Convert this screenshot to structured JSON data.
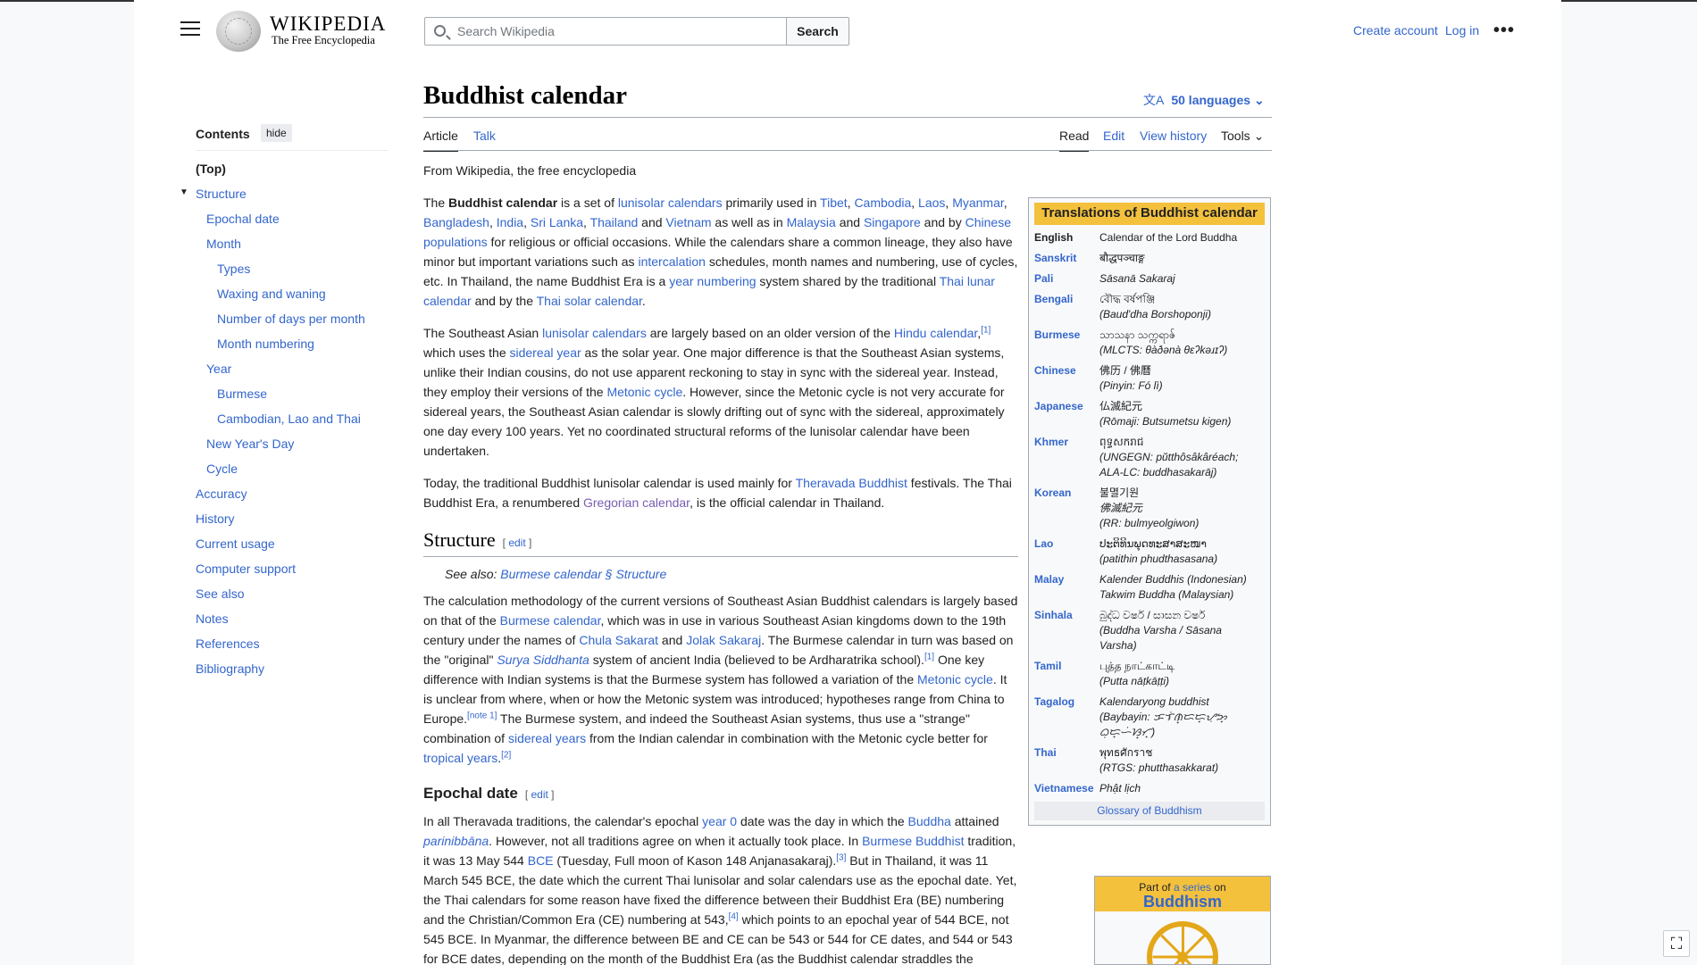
{
  "header": {
    "wordmark": "WIKIPEDIA",
    "tagline": "The Free Encyclopedia",
    "search_placeholder": "Search Wikipedia",
    "search_button": "Search",
    "create_account": "Create account",
    "log_in": "Log in"
  },
  "toc": {
    "heading": "Contents",
    "hide": "hide",
    "items": [
      "(Top)",
      "Structure",
      "Epochal date",
      "Month",
      "Types",
      "Waxing and waning",
      "Number of days per month",
      "Month numbering",
      "Year",
      "Burmese",
      "Cambodian, Lao and Thai",
      "New Year's Day",
      "Cycle",
      "Accuracy",
      "History",
      "Current usage",
      "Computer support",
      "See also",
      "Notes",
      "References",
      "Bibliography"
    ]
  },
  "page": {
    "title": "Buddhist calendar",
    "languages": "50 languages",
    "tabs": {
      "article": "Article",
      "talk": "Talk",
      "read": "Read",
      "edit": "Edit",
      "history": "View history",
      "tools": "Tools"
    },
    "from": "From Wikipedia, the free encyclopedia"
  },
  "article": {
    "p1": {
      "t1": "The ",
      "b": "Buddhist calendar",
      "t2": " is a set of ",
      "l1": "lunisolar calendars",
      "t3": " primarily used in ",
      "l2": "Tibet",
      "l3": "Cambodia",
      "l4": "Laos",
      "l5": "Myanmar",
      "l6": "Bangladesh",
      "l7": "India",
      "l8": "Sri Lanka",
      "l9": "Thailand",
      "t4": " and ",
      "l10": "Vietnam",
      "t5": " as well as in ",
      "l11": "Malaysia",
      "l12": "Singapore",
      "t6": " and by ",
      "l13": "Chinese populations",
      "t7": " for religious or official occasions. While the calendars share a common lineage, they also have minor but important variations such as ",
      "l14": "intercalation",
      "t8": " schedules, month names and numbering, use of cycles, etc. In Thailand, the name Buddhist Era is a ",
      "l15": "year numbering",
      "t9": " system shared by the traditional ",
      "l16": "Thai lunar calendar",
      "t10": " and by the ",
      "l17": "Thai solar calendar",
      "t11": "."
    },
    "p2": {
      "t1": "The Southeast Asian ",
      "l1": "lunisolar calendars",
      "t2": " are largely based on an older version of the ",
      "l2": "Hindu calendar",
      "r1": "[1]",
      "t3": " which uses the ",
      "l3": "sidereal year",
      "t4": " as the solar year. One major difference is that the Southeast Asian systems, unlike their Indian cousins, do not use apparent reckoning to stay in sync with the sidereal year. Instead, they employ their versions of the ",
      "l4": "Metonic cycle",
      "t5": ". However, since the Metonic cycle is not very accurate for sidereal years, the Southeast Asian calendar is slowly drifting out of sync with the sidereal, approximately one day every 100 years. Yet no coordinated structural reforms of the lunisolar calendar have been undertaken."
    },
    "p3": {
      "t1": "Today, the traditional Buddhist lunisolar calendar is used mainly for ",
      "l1": "Theravada Buddhist",
      "t2": " festivals. The Thai Buddhist Era, a renumbered ",
      "l2": "Gregorian calendar",
      "t3": ", is the official calendar in Thailand."
    },
    "h_structure": "Structure",
    "edit": "edit",
    "hat": {
      "t": "See also: ",
      "l": "Burmese calendar § Structure"
    },
    "p4": {
      "t1": "The calculation methodology of the current versions of Southeast Asian Buddhist calendars is largely based on that of the ",
      "l1": "Burmese calendar",
      "t2": ", which was in use in various Southeast Asian kingdoms down to the 19th century under the names of ",
      "l2": "Chula Sakarat",
      "t3": " and ",
      "l3": "Jolak Sakaraj",
      "t4": ". The Burmese calendar in turn was based on the \"original\" ",
      "l4": "Surya Siddhanta",
      "t5": " system of ancient India (believed to be Ardharatrika school).",
      "r1": "[1]",
      "t6": " One key difference with Indian systems is that the Burmese system has followed a variation of the ",
      "l5": "Metonic cycle",
      "t7": ". It is unclear from where, when or how the Metonic system was introduced; hypotheses range from China to Europe.",
      "r2": "[note 1]",
      "t8": " The Burmese system, and indeed the Southeast Asian systems, thus use a \"strange\" combination of ",
      "l6": "sidereal years",
      "t9": " from the Indian calendar in combination with the Metonic cycle better for ",
      "l7": "tropical years",
      "t10": ".",
      "r3": "[2]"
    },
    "h_epochal": "Epochal date",
    "p5": {
      "t1": "In all Theravada traditions, the calendar's epochal ",
      "l1": "year 0",
      "t2": " date was the day in which the ",
      "l2": "Buddha",
      "t3": " attained ",
      "l3": "parinibbāna",
      "t4": ". However, not all traditions agree on when it actually took place. In ",
      "l4": "Burmese Buddhist",
      "t5": " tradition, it was 13 May 544 ",
      "l5": "BCE",
      "t6": " (Tuesday, Full moon of Kason 148 Anjanasakaraj).",
      "r1": "[3]",
      "t7": " But in Thailand, it was 11 March 545 BCE, the date which the current Thai lunisolar and solar calendars use as the epochal date. Yet, the Thai calendars for some reason have fixed the difference between their Buddhist Era (BE) numbering and the Christian/Common Era (CE) numbering at 543,",
      "r2": "[4]",
      "t8": " which points to an epochal year of 544 BCE, not 545 BCE. In Myanmar, the difference between BE and CE can be 543 or 544 for CE dates, and 544 or 543 for BCE dates, depending on the month of the Buddhist Era (as the Buddhist calendar straddles the Gregorian calendar—"
    }
  },
  "infobox": {
    "title": "Translations of Buddhist calendar",
    "rows": [
      {
        "k": "English",
        "v": "Calendar of the Lord Buddha"
      },
      {
        "k": "Sanskrit",
        "v": "बौद्धपञ्चाङ्ग"
      },
      {
        "k": "Pali",
        "v": "Sāsanā Sakaraj"
      },
      {
        "k": "Bengali",
        "v": "বৌদ্ধ বর্ষপঞ্জি",
        "v2": "(Baud'dha Borshoponji)"
      },
      {
        "k": "Burmese",
        "v": "သာသနာ သက္ကရာဇ်",
        "v2": "(MLCTS: θàðənà θɛʔkəɹɪʔ)"
      },
      {
        "k": "Chinese",
        "v": "佛历 / 佛曆",
        "v2": "(Pinyin: Fó lì)"
      },
      {
        "k": "Japanese",
        "v": "仏滅紀元",
        "v2": "(Rōmaji: Butsumetsu kigen)"
      },
      {
        "k": "Khmer",
        "v": "ពុទ្ធសករាជ",
        "v2": "(UNGEGN: pŭtthôsâkâréach;",
        "v3": "ALA-LC: buddhasakarāj)"
      },
      {
        "k": "Korean",
        "v": "불멸기원",
        "v2": "佛滅紀元",
        "v3": "(RR: bulmyeolgiwon)"
      },
      {
        "k": "Lao",
        "v": "ປະຕິທິນພຸດທະສາສະໜາ",
        "v2": "(patithin phudthasasana)"
      },
      {
        "k": "Malay",
        "v": "Kalender Buddhis (Indonesian)",
        "v2": "Takwim Buddha (Malaysian)"
      },
      {
        "k": "Sinhala",
        "v": "බුද්ධ වර්ෂ / සාසන වර්ෂ",
        "v2": "(Buddha Varsha / Sāsana",
        "v3": "Varsha)"
      },
      {
        "k": "Tamil",
        "v": "புத்த நாட்காட்டி",
        "v2": "(Putta nāṭkāṭṭi)"
      },
      {
        "k": "Tagalog",
        "v": "Kalendaryong buddhist",
        "v2": "(Baybayin: ᜃᜎᜒᜈ᜔ᜇᜇ᜔ᜌᜓᜅ᜔",
        "v3": "ᜊᜓᜇ᜔ᜑᜒᜐ᜔ᜆ᜔)"
      },
      {
        "k": "Thai",
        "v": "พุทธศักราช",
        "v2": "(RTGS: phutthasakkarat)"
      },
      {
        "k": "Vietnamese",
        "v": "Phật lịch"
      }
    ],
    "footer": "Glossary of Buddhism"
  },
  "series": {
    "part": "Part of",
    "a_series": "a series",
    "on": "on",
    "name": "Buddhism"
  }
}
